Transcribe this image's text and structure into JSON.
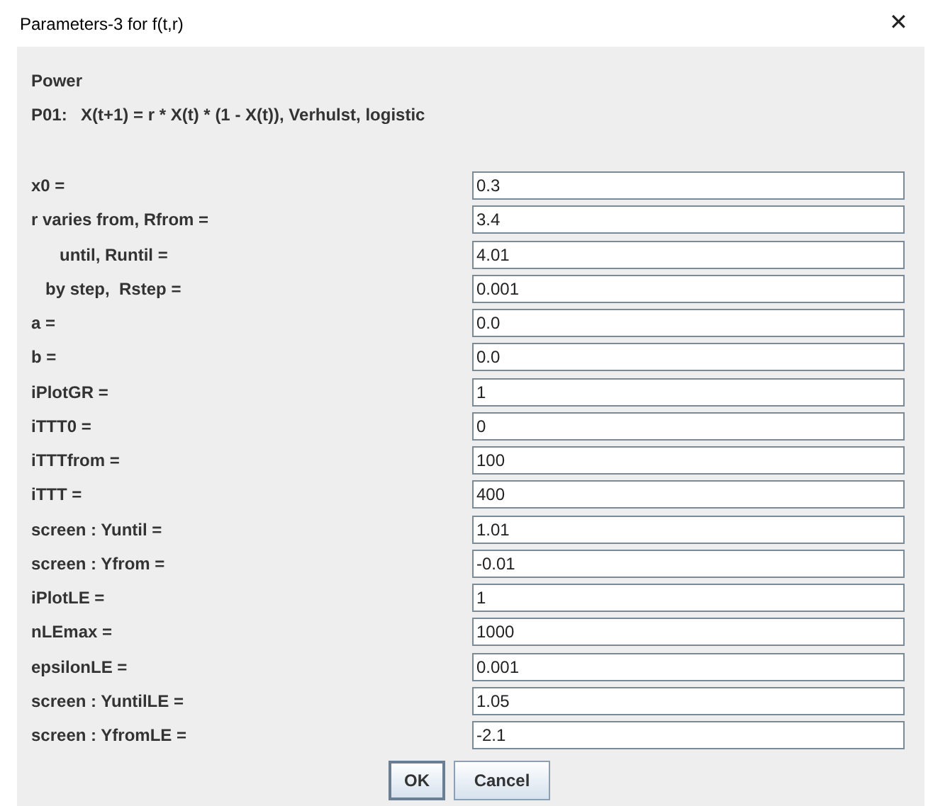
{
  "window": {
    "title": "Parameters-3 for f(t,r)",
    "close": "✕"
  },
  "header": {
    "title": "Power",
    "formula_id": "P01:",
    "formula": "X(t+1) = r * X(t) * (1 - X(t)), Verhulst, logistic"
  },
  "fields": [
    {
      "label": "x0 =",
      "value": "0.3"
    },
    {
      "label": "r varies from, Rfrom =",
      "value": "3.4"
    },
    {
      "label": "      until, Runtil =",
      "value": "4.01"
    },
    {
      "label": "   by step,  Rstep =",
      "value": "0.001"
    },
    {
      "label": "a =",
      "value": "0.0"
    },
    {
      "label": "b =",
      "value": "0.0"
    },
    {
      "label": "iPlotGR =",
      "value": "1"
    },
    {
      "label": "iTTT0 =",
      "value": "0"
    },
    {
      "label": "iTTTfrom =",
      "value": "100"
    },
    {
      "label": "iTTT =",
      "value": "400"
    },
    {
      "label": "screen : Yuntil =",
      "value": "1.01"
    },
    {
      "label": "screen : Yfrom =",
      "value": "-0.01"
    },
    {
      "label": "iPlotLE =",
      "value": "1"
    },
    {
      "label": "nLEmax =",
      "value": "1000"
    },
    {
      "label": "epsilonLE =",
      "value": "0.001"
    },
    {
      "label": "screen : YuntilLE =",
      "value": "1.05"
    },
    {
      "label": "screen : YfromLE =",
      "value": "-2.1"
    }
  ],
  "buttons": [
    {
      "label": "OK",
      "default": true
    },
    {
      "label": "Cancel",
      "default": false
    }
  ]
}
